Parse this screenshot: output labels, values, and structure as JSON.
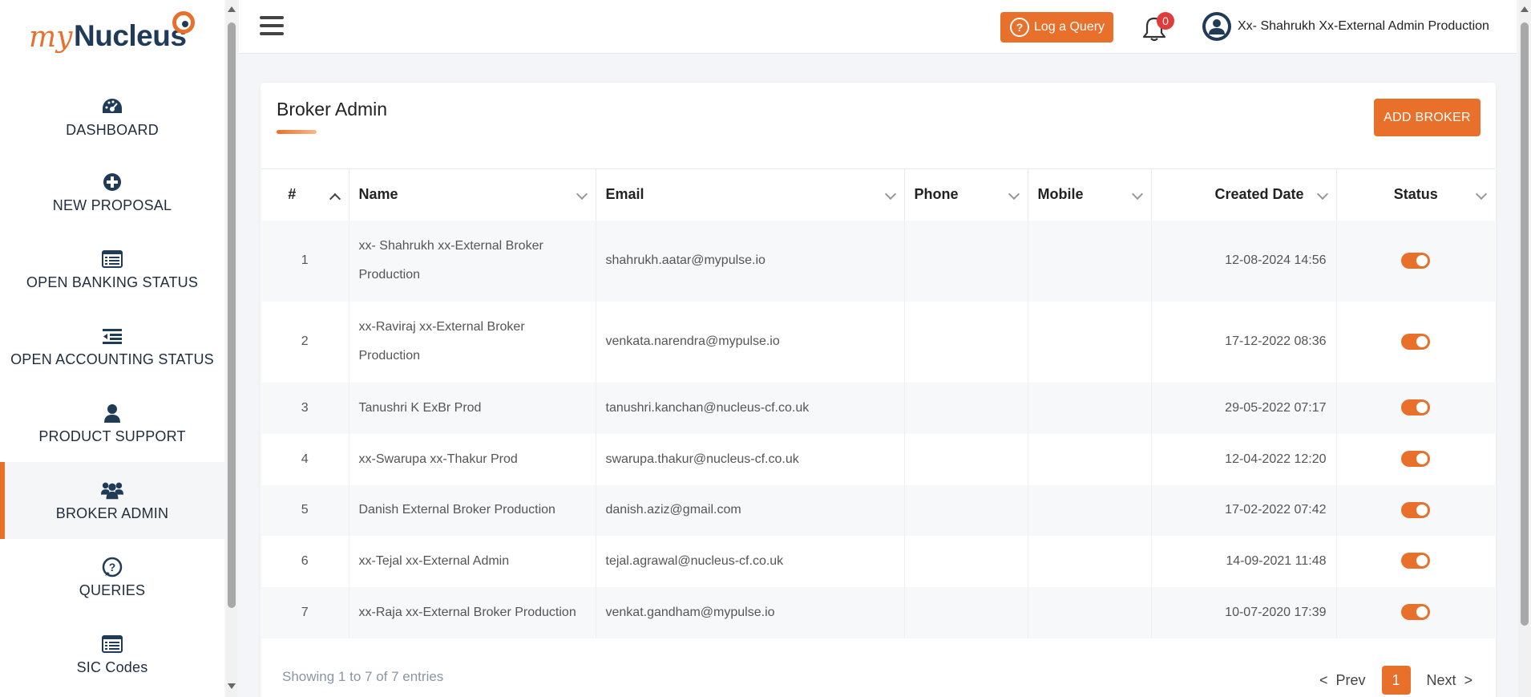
{
  "brand": {
    "prefix": "my",
    "name": "Nucleus",
    "accent": "#e8702a",
    "navy": "#1f3b58"
  },
  "sidebar": {
    "items": [
      {
        "label": "DASHBOARD",
        "icon": "dashboard-icon"
      },
      {
        "label": "NEW PROPOSAL",
        "icon": "plus-circle-icon"
      },
      {
        "label": "OPEN BANKING STATUS",
        "icon": "list-icon"
      },
      {
        "label": "OPEN ACCOUNTING STATUS",
        "icon": "indent-list-icon"
      },
      {
        "label": "PRODUCT SUPPORT",
        "icon": "user-icon"
      },
      {
        "label": "BROKER ADMIN",
        "icon": "users-icon",
        "active": true
      },
      {
        "label": "QUERIES",
        "icon": "question-icon"
      },
      {
        "label": "SIC Codes",
        "icon": "list-icon"
      }
    ]
  },
  "header": {
    "query_label": "Log a Query",
    "notification_count": "0",
    "user_name": "Xx- Shahrukh Xx-External Admin Production"
  },
  "page": {
    "title": "Broker Admin",
    "add_label": "ADD BROKER"
  },
  "table": {
    "columns": [
      "#",
      "Name",
      "Email",
      "Phone",
      "Mobile",
      "Created Date",
      "Status"
    ],
    "rows": [
      {
        "num": "1",
        "name_line1": "xx- Shahrukh xx-External Broker",
        "name_line2": "Production",
        "email": "shahrukh.aatar@mypulse.io",
        "phone": "",
        "mobile": "",
        "created": "12-08-2024 14:56",
        "active": true
      },
      {
        "num": "2",
        "name_line1": "xx-Raviraj xx-External Broker",
        "name_line2": "Production",
        "email": "venkata.narendra@mypulse.io",
        "phone": "",
        "mobile": "",
        "created": "17-12-2022 08:36",
        "active": true
      },
      {
        "num": "3",
        "name_line1": "Tanushri K ExBr Prod",
        "name_line2": "",
        "email": "tanushri.kanchan@nucleus-cf.co.uk",
        "phone": "",
        "mobile": "",
        "created": "29-05-2022 07:17",
        "active": true
      },
      {
        "num": "4",
        "name_line1": "xx-Swarupa xx-Thakur Prod",
        "name_line2": "",
        "email": "swarupa.thakur@nucleus-cf.co.uk",
        "phone": "",
        "mobile": "",
        "created": "12-04-2022 12:20",
        "active": true
      },
      {
        "num": "5",
        "name_line1": "Danish External Broker Production",
        "name_line2": "",
        "email": "danish.aziz@gmail.com",
        "phone": "",
        "mobile": "",
        "created": "17-02-2022 07:42",
        "active": true
      },
      {
        "num": "6",
        "name_line1": "xx-Tejal xx-External Admin",
        "name_line2": "",
        "email": "tejal.agrawal@nucleus-cf.co.uk",
        "phone": "",
        "mobile": "",
        "created": "14-09-2021 11:48",
        "active": true
      },
      {
        "num": "7",
        "name_line1": "xx-Raja xx-External Broker Production",
        "name_line2": "",
        "email": "venkat.gandham@mypulse.io",
        "phone": "",
        "mobile": "",
        "created": "10-07-2020 17:39",
        "active": true
      }
    ]
  },
  "pagination": {
    "info": "Showing 1 to 7 of 7 entries",
    "prev_label": "Prev",
    "next_label": "Next",
    "current": "1",
    "prev_arrow": "<",
    "next_arrow": ">"
  }
}
